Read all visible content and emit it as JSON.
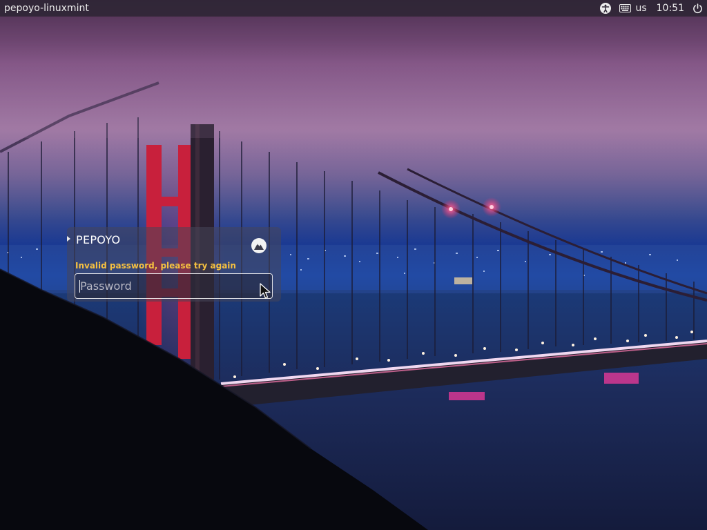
{
  "top_panel": {
    "hostname": "pepoyo-linuxmint",
    "accessibility_icon": "accessibility-icon",
    "keyboard_icon": "keyboard-icon",
    "keyboard_layout": "us",
    "clock": "10:51",
    "power_icon": "power-icon"
  },
  "login": {
    "user_name": "PEPOYO",
    "session_icon": "mint-session-icon",
    "error_message": "Invalid password, please try again",
    "password_placeholder": "Password",
    "password_value": ""
  },
  "colors": {
    "error": "#f5c040",
    "panel": "#2d2634",
    "bridge_red": "#ff3a6a"
  }
}
